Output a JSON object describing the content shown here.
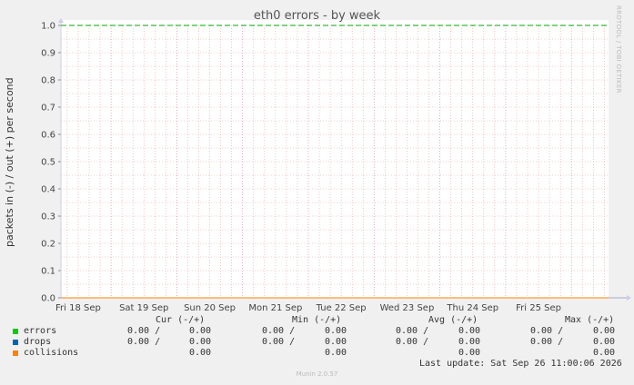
{
  "chart_data": {
    "type": "line",
    "title": "eth0 errors - by week",
    "ylabel": "packets in (-) / out (+) per second",
    "xlabel": "",
    "ylim": [
      0,
      1.0
    ],
    "y_ticks": [
      "0.0",
      "0.1",
      "0.2",
      "0.3",
      "0.4",
      "0.5",
      "0.6",
      "0.7",
      "0.8",
      "0.9",
      "1.0"
    ],
    "x_ticks": [
      "Fri 18 Sep",
      "Sat 19 Sep",
      "Sun 20 Sep",
      "Mon 21 Sep",
      "Tue 22 Sep",
      "Wed 23 Sep",
      "Thu 24 Sep",
      "Fri 25 Sep"
    ],
    "grid": true,
    "threshold_line": {
      "value": 1.0,
      "color": "#00aa00",
      "style": "dashed"
    },
    "series": [
      {
        "name": "errors",
        "color": "#00cc00",
        "values": [
          0,
          0,
          0,
          0,
          0,
          0,
          0,
          0
        ]
      },
      {
        "name": "drops",
        "color": "#0066b3",
        "values": [
          0,
          0,
          0,
          0,
          0,
          0,
          0,
          0
        ]
      },
      {
        "name": "collisions",
        "color": "#ff8000",
        "values": [
          0,
          0,
          0,
          0,
          0,
          0,
          0,
          0
        ]
      }
    ]
  },
  "watermark": "RRDTOOL / TOBI OETIKER",
  "legend": {
    "headers": {
      "cur": "Cur (-/+)",
      "min": "Min (-/+)",
      "avg": "Avg (-/+)",
      "max": "Max (-/+)"
    },
    "rows": [
      {
        "label": "errors",
        "color": "#00cc00",
        "cur_in": "0.00 /",
        "cur_out": "0.00",
        "min_in": "0.00 /",
        "min_out": "0.00",
        "avg_in": "0.00 /",
        "avg_out": "0.00",
        "max_in": "0.00 /",
        "max_out": "0.00"
      },
      {
        "label": "drops",
        "color": "#0066b3",
        "cur_in": "0.00 /",
        "cur_out": "0.00",
        "min_in": "0.00 /",
        "min_out": "0.00",
        "avg_in": "0.00 /",
        "avg_out": "0.00",
        "max_in": "0.00 /",
        "max_out": "0.00"
      },
      {
        "label": "collisions",
        "color": "#ff8000",
        "cur_in": "",
        "cur_out": "0.00",
        "min_in": "",
        "min_out": "0.00",
        "avg_in": "",
        "avg_out": "0.00",
        "max_in": "",
        "max_out": "0.00"
      }
    ],
    "last_update": "Last update: Sat Sep 26 11:00:06 2026"
  },
  "footer": "Munin 2.0.57"
}
